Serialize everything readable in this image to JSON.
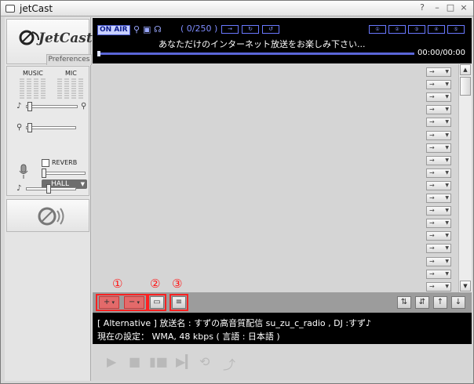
{
  "window": {
    "title": "jetCast",
    "controls": [
      "?",
      "–",
      "□",
      "×"
    ]
  },
  "sidebar": {
    "logo_text": "JetCast",
    "preferences_tab": "Preferences",
    "mixer": {
      "music_label": "MUSIC",
      "mic_label": "MIC",
      "reverb_label": "REVERB",
      "reverb_checked": false,
      "effect_selected": "HALL"
    }
  },
  "display": {
    "onair_label": "ON AIR",
    "counter": "( 0/250 )",
    "ticker": "あなただけのインターネット放送をお楽しみ下さい...",
    "time": "00:00/00:00"
  },
  "playlist": {
    "row_button_glyph": "→",
    "rows": 18
  },
  "toolbar": {
    "add_label": "+",
    "remove_label": "−",
    "callouts": [
      "①",
      "②",
      "③"
    ]
  },
  "info": {
    "line1": "[ Alternative ] 放送名 : すずの高音質配信 su_zu_c_radio , DJ :すず♪",
    "line2": "現在の設定： WMA, 48 kbps ( 言語 : 日本語 )"
  },
  "colors": {
    "display_bg": "#000000",
    "display_accent": "#6a78ff",
    "highlight": "#ff2020"
  }
}
